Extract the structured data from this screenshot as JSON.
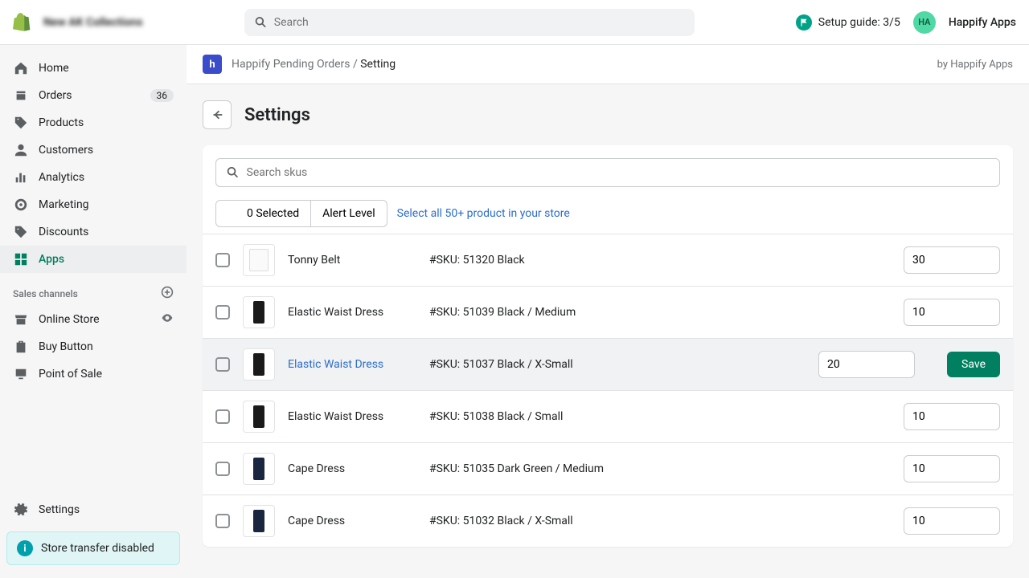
{
  "header": {
    "store_name": "New AK Collections",
    "search_placeholder": "Search",
    "setup_guide": "Setup guide: 3/5",
    "avatar_initials": "HA",
    "display_name": "Happify Apps"
  },
  "sidebar": {
    "items": [
      {
        "label": "Home"
      },
      {
        "label": "Orders",
        "badge": "36"
      },
      {
        "label": "Products"
      },
      {
        "label": "Customers"
      },
      {
        "label": "Analytics"
      },
      {
        "label": "Marketing"
      },
      {
        "label": "Discounts"
      },
      {
        "label": "Apps"
      }
    ],
    "section_title": "Sales channels",
    "channels": [
      {
        "label": "Online Store"
      },
      {
        "label": "Buy Button"
      },
      {
        "label": "Point of Sale"
      }
    ],
    "settings_label": "Settings",
    "notice": "Store transfer disabled"
  },
  "app_header": {
    "app_icon": "h",
    "breadcrumb_app": "Happify Pending Orders",
    "breadcrumb_current": "Setting",
    "attribution": "by Happify Apps"
  },
  "page": {
    "title": "Settings",
    "sku_search_placeholder": "Search skus",
    "selected_label": "0 Selected",
    "alert_level_label": "Alert Level",
    "select_all_label": "Select all 50+ product in your store",
    "save_label": "Save",
    "rows": [
      {
        "name": "Tonny Belt",
        "sku": "#SKU: 51320 Black",
        "qty": "30",
        "thumb": "white"
      },
      {
        "name": "Elastic Waist Dress",
        "sku": "#SKU: 51039 Black / Medium",
        "qty": "10",
        "thumb": "black"
      },
      {
        "name": "Elastic Waist Dress",
        "sku": "#SKU: 51037 Black / X-Small",
        "qty": "20",
        "thumb": "black",
        "highlight": true,
        "save": true
      },
      {
        "name": "Elastic Waist Dress",
        "sku": "#SKU: 51038 Black / Small",
        "qty": "10",
        "thumb": "black"
      },
      {
        "name": "Cape Dress",
        "sku": "#SKU: 51035 Dark Green / Medium",
        "qty": "10",
        "thumb": "navy"
      },
      {
        "name": "Cape Dress",
        "sku": "#SKU: 51032 Black / X-Small",
        "qty": "10",
        "thumb": "navy"
      }
    ]
  }
}
